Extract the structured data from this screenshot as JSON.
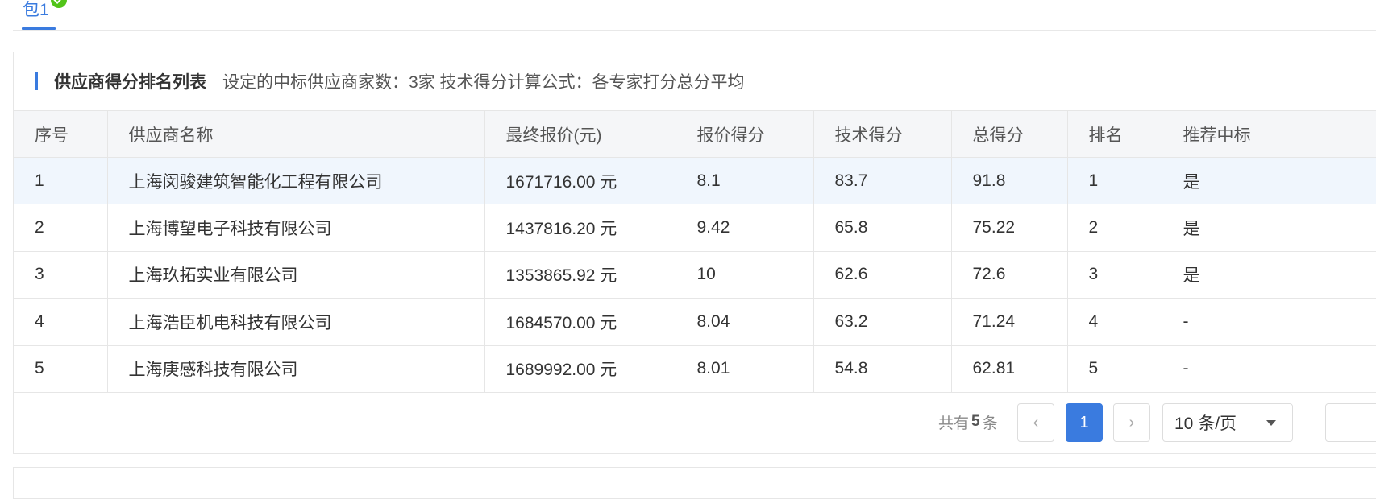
{
  "tab": {
    "label": "包1"
  },
  "panel": {
    "title": "供应商得分排名列表",
    "info": "设定的中标供应商家数：3家  技术得分计算公式：各专家打分总分平均"
  },
  "table": {
    "headers": [
      "序号",
      "供应商名称",
      "最终报价(元)",
      "报价得分",
      "技术得分",
      "总得分",
      "排名",
      "推荐中标"
    ],
    "rows": [
      [
        "1",
        "上海闵骏建筑智能化工程有限公司",
        "1671716.00 元",
        "8.1",
        "83.7",
        "91.8",
        "1",
        "是"
      ],
      [
        "2",
        "上海博望电子科技有限公司",
        "1437816.20 元",
        "9.42",
        "65.8",
        "75.22",
        "2",
        "是"
      ],
      [
        "3",
        "上海玖拓实业有限公司",
        "1353865.92 元",
        "10",
        "62.6",
        "72.6",
        "3",
        "是"
      ],
      [
        "4",
        "上海浩臣机电科技有限公司",
        "1684570.00 元",
        "8.04",
        "63.2",
        "71.24",
        "4",
        "-"
      ],
      [
        "5",
        "上海庚感科技有限公司",
        "1689992.00 元",
        "8.01",
        "54.8",
        "62.81",
        "5",
        "-"
      ]
    ]
  },
  "pagination": {
    "total_prefix": "共有",
    "total_count": "5",
    "total_suffix": "条",
    "prev": "‹",
    "current_page": "1",
    "next": "›",
    "page_size": "10 条/页"
  }
}
